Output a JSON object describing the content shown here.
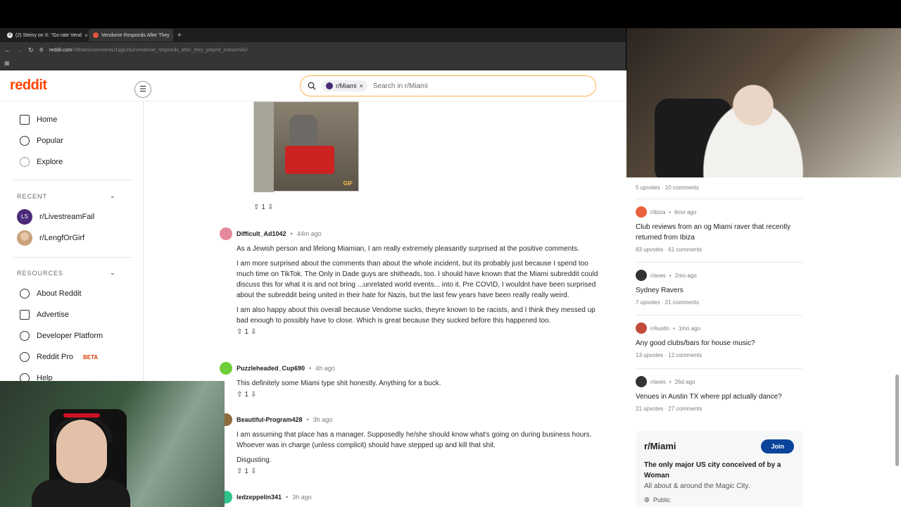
{
  "browser": {
    "tabs": [
      {
        "label": "(2) Steiny on X: \"Go rate Vend",
        "close": "×"
      },
      {
        "label": "Vendome Responds After They",
        "close": "×"
      }
    ],
    "new_tab": "+",
    "url_host": "reddit.com",
    "url_path": "/r/Miami/comments/1qgk1bu/vendome_responds_after_they_played_antisemitic/"
  },
  "header": {
    "logo": "reddit",
    "search_chip": "r/Miami",
    "search_chip_close": "×",
    "search_placeholder": "Search in r/Miami"
  },
  "sidebar": {
    "items": [
      {
        "label": "Home"
      },
      {
        "label": "Popular"
      },
      {
        "label": "Explore"
      }
    ],
    "recent_title": "RECENT",
    "recent": [
      {
        "label": "r/LivestreamFail",
        "avatar_text": "LS"
      },
      {
        "label": "r/LengfOrGirf"
      }
    ],
    "resources_title": "RESOURCES",
    "resources": [
      {
        "label": "About Reddit"
      },
      {
        "label": "Advertise"
      },
      {
        "label": "Developer Platform"
      },
      {
        "label": "Reddit Pro",
        "badge": "BETA"
      },
      {
        "label": "Help"
      }
    ]
  },
  "post": {
    "votes": "1",
    "gif_watermark": "GIF"
  },
  "comments": [
    {
      "user": "Difficult_Ad1042",
      "time": "44m ago",
      "paragraphs": [
        "As a Jewish person and lifelong Miamian, I am really extremely pleasantly surprised at the positive comments.",
        "I am more surprised about the comments than about the whole incident, but its probably just because I spend too much time on TikTok. The Only in Dade guys are shitheads, too. I should have known that the Miami subreddit could discuss this for what it is and not bring ...unrelated world events... into it. Pre COVID, I wouldnt have been surprised about the subreddit being united in their hate for Nazis, but the last few years have been really really weird.",
        "I am also happy about this overall because Vendome sucks, theyre known to be racists, and I think they messed up bad enough to possibly have to close. Which is great because they sucked before this happened too."
      ],
      "votes": "1",
      "avatar_color": "#e48a9c"
    },
    {
      "user": "Puzzleheaded_Cup690",
      "time": "4h ago",
      "paragraphs": [
        "This definitely some Miami type shit honestly. Anything for a buck."
      ],
      "votes": "1",
      "avatar_color": "#6fcf3a"
    },
    {
      "user": "Beautiful-Program428",
      "time": "3h ago",
      "paragraphs": [
        "I am assuming that place has a manager. Supposedly he/she should know what's going on during business hours. Whoever was in charge (unless complicit) should have stepped up and kill that shit.",
        "Disgusting."
      ],
      "votes": "1",
      "avatar_color": "#8d6b3c"
    },
    {
      "user": "ledzeppelin341",
      "time": "3h ago",
      "paragraphs": [],
      "votes": "",
      "avatar_color": "#2bc48a"
    }
  ],
  "related": [
    {
      "stats": "5 upvotes · 10 comments"
    },
    {
      "sub": "r/ibiza",
      "time": "6mo ago",
      "title": "Club reviews from an og Miami raver that recently returned from Ibiza",
      "stats": "83 upvotes · 61 comments",
      "color": "#e8603c"
    },
    {
      "sub": "r/aves",
      "time": "2mo ago",
      "title": "Sydney Ravers",
      "stats": "7 upvotes · 21 comments",
      "color": "#333333"
    },
    {
      "sub": "r/Austin",
      "time": "1mo ago",
      "title": "Any good clubs/bars for house music?",
      "stats": "13 upvotes · 12 comments",
      "color": "#c24a3a"
    },
    {
      "sub": "r/aves",
      "time": "26d ago",
      "title": "Venues in Austin TX where ppl actually dance?",
      "stats": "21 upvotes · 27 comments",
      "color": "#333333"
    }
  ],
  "subcard": {
    "name": "r/Miami",
    "join": "Join",
    "desc": "The only major US city conceived of by a Woman",
    "about": "All about & around the Magic City.",
    "visibility": "Public"
  },
  "colors": {
    "brand": "#ff4500",
    "join": "#0a449b",
    "search_border": "#ffb34d"
  }
}
